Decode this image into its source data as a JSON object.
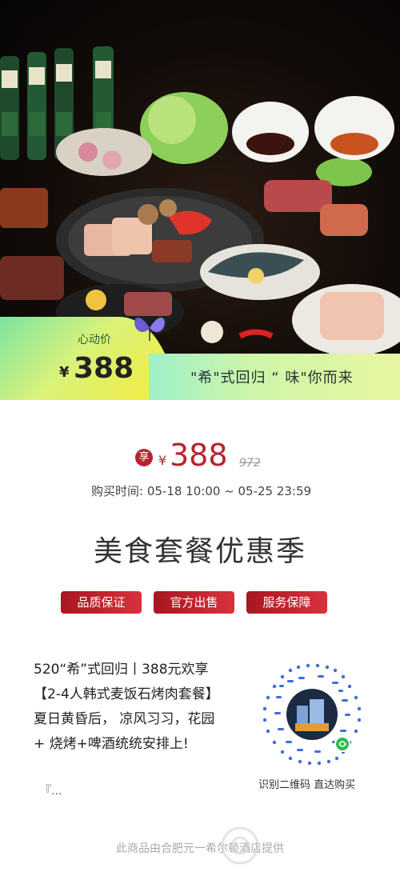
{
  "hero": {
    "badge_label": "心动价",
    "badge_currency": "¥",
    "badge_price": "388",
    "slogan": "\"希\"式回归 “ 味\"你而来"
  },
  "price": {
    "enjoy": "享",
    "currency": "¥",
    "value": "388",
    "original": "972"
  },
  "purchase_time": "购买时间:  05-18 10:00 ~ 05-25 23:59",
  "headline": "美食套餐优惠季",
  "tags": [
    "品质保证",
    "官方出售",
    "服务保障"
  ],
  "description": "520“希”式回归丨388元欢享【2-4人韩式麦饭石烤肉套餐】 夏日黄昏后， 凉风习习，花园 + 烧烤+啤酒统统安排上!",
  "description_more": "『...",
  "qr_caption": "识别二维码 直达购买",
  "footer": "此商品由合肥元一希尔顿酒店提供",
  "colors": {
    "accent_red": "#b9232e",
    "badge_green": "#7de3a0",
    "badge_yellow": "#f6ec3a"
  },
  "icons": [
    "food-photo",
    "butterfly-icon",
    "qr-code",
    "mini-program-icon",
    "watermark-logo"
  ]
}
